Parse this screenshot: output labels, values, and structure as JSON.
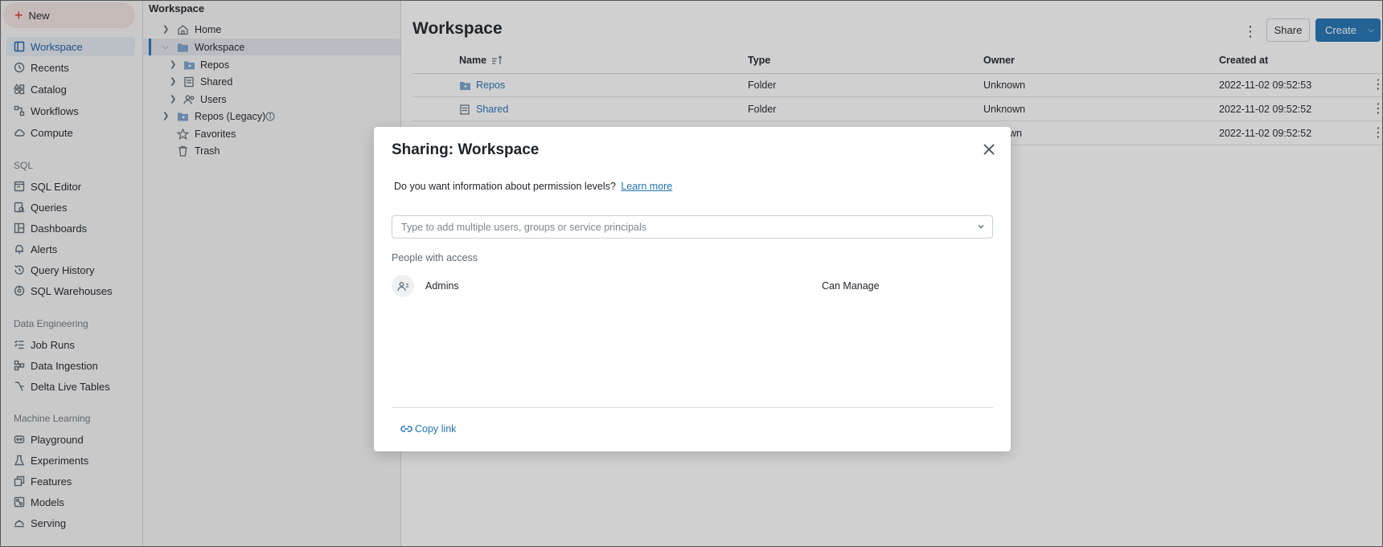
{
  "sidebar": {
    "new_label": "New",
    "items_top": [
      {
        "label": "Workspace",
        "icon": "workspace-icon",
        "active": true
      },
      {
        "label": "Recents",
        "icon": "clock-icon"
      },
      {
        "label": "Catalog",
        "icon": "catalog-icon"
      },
      {
        "label": "Workflows",
        "icon": "workflows-icon"
      },
      {
        "label": "Compute",
        "icon": "cloud-icon"
      }
    ],
    "sql_label": "SQL",
    "items_sql": [
      {
        "label": "SQL Editor",
        "icon": "sql-editor-icon"
      },
      {
        "label": "Queries",
        "icon": "queries-icon"
      },
      {
        "label": "Dashboards",
        "icon": "dashboards-icon"
      },
      {
        "label": "Alerts",
        "icon": "bell-icon"
      },
      {
        "label": "Query History",
        "icon": "history-icon"
      },
      {
        "label": "SQL Warehouses",
        "icon": "warehouse-icon"
      }
    ],
    "de_label": "Data Engineering",
    "items_de": [
      {
        "label": "Job Runs",
        "icon": "job-runs-icon"
      },
      {
        "label": "Data Ingestion",
        "icon": "ingestion-icon"
      },
      {
        "label": "Delta Live Tables",
        "icon": "delta-icon"
      }
    ],
    "ml_label": "Machine Learning",
    "items_ml": [
      {
        "label": "Playground",
        "icon": "playground-icon"
      },
      {
        "label": "Experiments",
        "icon": "flask-icon"
      },
      {
        "label": "Features",
        "icon": "features-icon"
      },
      {
        "label": "Models",
        "icon": "models-icon"
      },
      {
        "label": "Serving",
        "icon": "serving-icon"
      }
    ]
  },
  "tree": {
    "title": "Workspace",
    "rows": [
      {
        "label": "Home",
        "icon": "home-icon"
      },
      {
        "label": "Workspace",
        "icon": "folder-icon"
      },
      {
        "label": "Repos",
        "icon": "repo-folder-icon"
      },
      {
        "label": "Shared",
        "icon": "shared-icon"
      },
      {
        "label": "Users",
        "icon": "users-icon"
      },
      {
        "label": "Repos (Legacy)",
        "icon": "repo-folder-icon"
      },
      {
        "label": "Favorites",
        "icon": "star-icon"
      },
      {
        "label": "Trash",
        "icon": "trash-icon"
      }
    ]
  },
  "main": {
    "title": "Workspace",
    "share_label": "Share",
    "create_label": "Create",
    "columns": {
      "name": "Name",
      "type": "Type",
      "owner": "Owner",
      "created": "Created at"
    },
    "rows": [
      {
        "name": "Repos",
        "type": "Folder",
        "owner": "Unknown",
        "created": "2022-11-02 09:52:53"
      },
      {
        "name": "Shared",
        "type": "Folder",
        "owner": "Unknown",
        "created": "2022-11-02 09:52:52"
      },
      {
        "name": "",
        "type": "",
        "owner": "own",
        "created": "2022-11-02 09:52:52"
      }
    ]
  },
  "modal": {
    "title": "Sharing: Workspace",
    "question": "Do you want information about permission levels?",
    "learn_more": "Learn more",
    "input_placeholder": "Type to add multiple users, groups or service principals",
    "people_label": "People with access",
    "people": [
      {
        "name": "Admins",
        "permission": "Can Manage"
      }
    ],
    "copy_link": "Copy link"
  },
  "colors": {
    "accent": "#2272b4",
    "new_plus": "#d62d20"
  }
}
